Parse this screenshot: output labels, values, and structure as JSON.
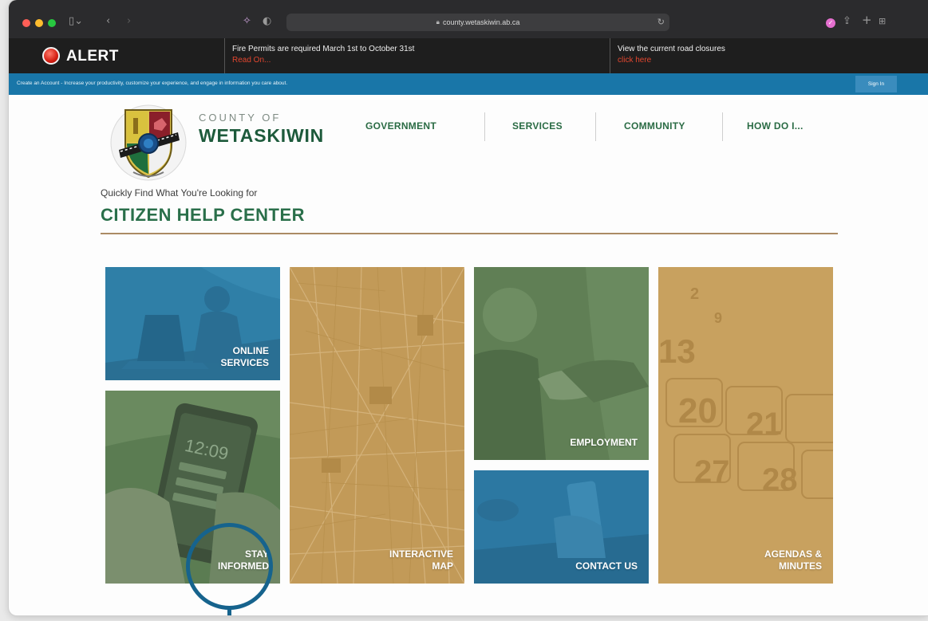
{
  "browser": {
    "url": "county.wetaskiwin.ab.ca"
  },
  "alert": {
    "label": "ALERT",
    "message1": "Fire Permits are required March 1st to October 31st",
    "link1": "Read On...",
    "message2": "View the current road closures",
    "link2": "click here"
  },
  "account_bar": {
    "text": "Create an Account - Increase your productivity, customize your experience, and engage in information you care about.",
    "signin": "Sign In"
  },
  "site": {
    "county_of": "COUNTY OF",
    "county_name": "WETASKIWIN"
  },
  "nav": {
    "items": [
      {
        "label": "GOVERNMENT"
      },
      {
        "label": "SERVICES"
      },
      {
        "label": "COMMUNITY"
      },
      {
        "label": "HOW DO I..."
      }
    ]
  },
  "help": {
    "tagline": "Quickly Find What You're Looking for",
    "title": "CITIZEN HELP CENTER"
  },
  "tiles": {
    "online_services": {
      "line1": "ONLINE",
      "line2": "SERVICES",
      "color": "#2f7fa7"
    },
    "stay_informed": {
      "line1": "STAY",
      "line2": "INFORMED",
      "color": "#5b7c52"
    },
    "interactive_map": {
      "line1": "INTERACTIVE",
      "line2": "MAP",
      "color": "#c29a58"
    },
    "employment": {
      "line1": "EMPLOYMENT",
      "color": "#607f55"
    },
    "contact_us": {
      "line1": "CONTACT US",
      "color": "#2c78a2"
    },
    "agendas_minutes": {
      "line1": "AGENDAS &",
      "line2": "MINUTES",
      "color": "#c8a15f"
    }
  },
  "colors": {
    "accent_green": "#2a6f4a",
    "alert_red": "#e2462f",
    "account_blue": "#1976a8",
    "rule_brown": "#ab8b64",
    "annotation_blue": "#16638d"
  }
}
